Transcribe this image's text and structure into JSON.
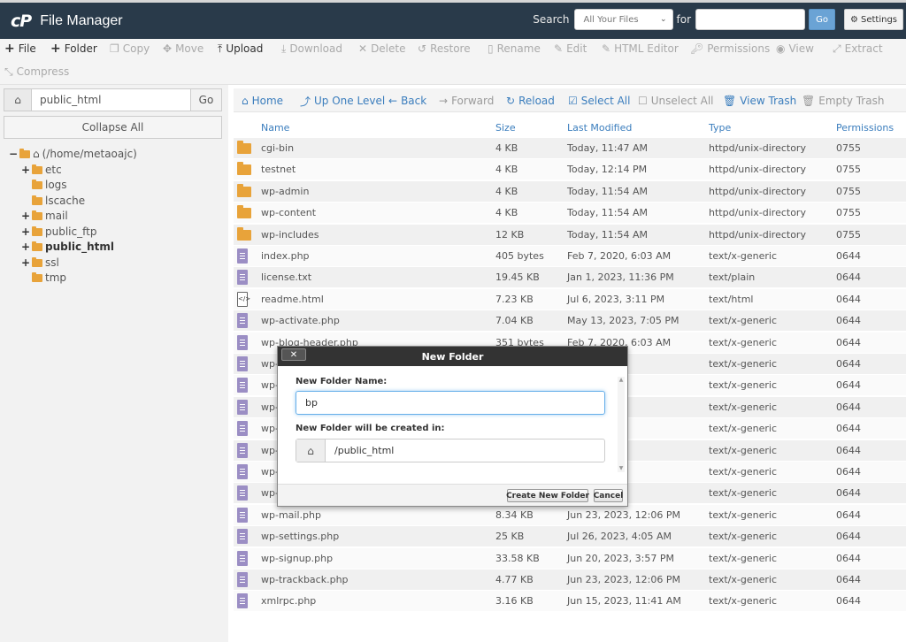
{
  "header": {
    "logo": "cP",
    "title": "File Manager",
    "search_label": "Search",
    "search_scope": "All Your Files",
    "for_label": "for",
    "search_value": "",
    "go_label": "Go",
    "settings_label": "Settings"
  },
  "toolbar": {
    "items": [
      {
        "label": "File",
        "icon": "plus-icon",
        "enabled": true
      },
      {
        "label": "Folder",
        "icon": "plus-icon",
        "enabled": true
      },
      {
        "label": "Copy",
        "icon": "copy-icon",
        "enabled": false
      },
      {
        "label": "Move",
        "icon": "move-icon",
        "enabled": false
      },
      {
        "label": "Upload",
        "icon": "upload-icon",
        "enabled": true
      },
      {
        "label": "Download",
        "icon": "download-icon",
        "enabled": false
      },
      {
        "label": "Delete",
        "icon": "delete-icon",
        "enabled": false
      },
      {
        "label": "Restore",
        "icon": "restore-icon",
        "enabled": false
      },
      {
        "label": "Rename",
        "icon": "rename-icon",
        "enabled": false
      },
      {
        "label": "Edit",
        "icon": "edit-icon",
        "enabled": false
      },
      {
        "label": "HTML Editor",
        "icon": "html-editor-icon",
        "enabled": false
      },
      {
        "label": "Permissions",
        "icon": "key-icon",
        "enabled": false
      },
      {
        "label": "View",
        "icon": "eye-icon",
        "enabled": false
      },
      {
        "label": "Extract",
        "icon": "extract-icon",
        "enabled": false
      },
      {
        "label": "Compress",
        "icon": "compress-icon",
        "enabled": false
      }
    ]
  },
  "sidebar": {
    "path_value": "public_html",
    "go_label": "Go",
    "collapse_label": "Collapse All",
    "tree": [
      {
        "label": "(/home/metaoajc)",
        "toggle": "−",
        "home": true
      },
      {
        "label": "etc",
        "toggle": "+"
      },
      {
        "label": "logs",
        "toggle": ""
      },
      {
        "label": "lscache",
        "toggle": ""
      },
      {
        "label": "mail",
        "toggle": "+"
      },
      {
        "label": "public_ftp",
        "toggle": "+"
      },
      {
        "label": "public_html",
        "toggle": "+",
        "bold": true
      },
      {
        "label": "ssl",
        "toggle": "+"
      },
      {
        "label": "tmp",
        "toggle": ""
      }
    ]
  },
  "nav": {
    "home": "Home",
    "up": "Up One Level",
    "back": "Back",
    "forward": "Forward",
    "reload": "Reload",
    "select_all": "Select All",
    "unselect_all": "Unselect All",
    "view_trash": "View Trash",
    "empty_trash": "Empty Trash"
  },
  "table": {
    "columns": [
      "Name",
      "Size",
      "Last Modified",
      "Type",
      "Permissions"
    ],
    "rows": [
      {
        "icon": "folder",
        "name": "cgi-bin",
        "size": "4 KB",
        "modified": "Today, 11:47 AM",
        "type": "httpd/unix-directory",
        "perms": "0755"
      },
      {
        "icon": "folder",
        "name": "testnet",
        "size": "4 KB",
        "modified": "Today, 12:14 PM",
        "type": "httpd/unix-directory",
        "perms": "0755"
      },
      {
        "icon": "folder",
        "name": "wp-admin",
        "size": "4 KB",
        "modified": "Today, 11:54 AM",
        "type": "httpd/unix-directory",
        "perms": "0755"
      },
      {
        "icon": "folder",
        "name": "wp-content",
        "size": "4 KB",
        "modified": "Today, 11:54 AM",
        "type": "httpd/unix-directory",
        "perms": "0755"
      },
      {
        "icon": "folder",
        "name": "wp-includes",
        "size": "12 KB",
        "modified": "Today, 11:54 AM",
        "type": "httpd/unix-directory",
        "perms": "0755"
      },
      {
        "icon": "file",
        "name": "index.php",
        "size": "405 bytes",
        "modified": "Feb 7, 2020, 6:03 AM",
        "type": "text/x-generic",
        "perms": "0644"
      },
      {
        "icon": "file",
        "name": "license.txt",
        "size": "19.45 KB",
        "modified": "Jan 1, 2023, 11:36 PM",
        "type": "text/plain",
        "perms": "0644"
      },
      {
        "icon": "html",
        "name": "readme.html",
        "size": "7.23 KB",
        "modified": "Jul 6, 2023, 3:11 PM",
        "type": "text/html",
        "perms": "0644"
      },
      {
        "icon": "file",
        "name": "wp-activate.php",
        "size": "7.04 KB",
        "modified": "May 13, 2023, 7:05 PM",
        "type": "text/x-generic",
        "perms": "0644"
      },
      {
        "icon": "file",
        "name": "wp-blog-header.php",
        "size": "351 bytes",
        "modified": "Feb 7, 2020, 6:03 AM",
        "type": "text/x-generic",
        "perms": "0644"
      },
      {
        "icon": "file",
        "name": "wp-",
        "size": "",
        "modified": "11:41 AM",
        "type": "text/x-generic",
        "perms": "0644"
      },
      {
        "icon": "file",
        "name": "wp-",
        "size": "",
        "modified": "10:08 AM",
        "type": "text/x-generic",
        "perms": "0644"
      },
      {
        "icon": "file",
        "name": "wp-",
        "size": "",
        "modified": "AM",
        "type": "text/x-generic",
        "perms": "0644"
      },
      {
        "icon": "file",
        "name": "wp-",
        "size": "",
        "modified": "4:18 PM",
        "type": "text/x-generic",
        "perms": "0644"
      },
      {
        "icon": "file",
        "name": "wp-",
        "size": "",
        "modified": "8:31 PM",
        "type": "text/x-generic",
        "perms": "0644"
      },
      {
        "icon": "file",
        "name": "wp-",
        "size": "",
        "modified": "9:46 AM",
        "type": "text/x-generic",
        "perms": "0644"
      },
      {
        "icon": "file",
        "name": "wp-",
        "size": "",
        "modified": "10:48 AM",
        "type": "text/x-generic",
        "perms": "0644"
      },
      {
        "icon": "file",
        "name": "wp-mail.php",
        "size": "8.34 KB",
        "modified": "Jun 23, 2023, 12:06 PM",
        "type": "text/x-generic",
        "perms": "0644"
      },
      {
        "icon": "file",
        "name": "wp-settings.php",
        "size": "25 KB",
        "modified": "Jul 26, 2023, 4:05 AM",
        "type": "text/x-generic",
        "perms": "0644"
      },
      {
        "icon": "file",
        "name": "wp-signup.php",
        "size": "33.58 KB",
        "modified": "Jun 20, 2023, 3:57 PM",
        "type": "text/x-generic",
        "perms": "0644"
      },
      {
        "icon": "file",
        "name": "wp-trackback.php",
        "size": "4.77 KB",
        "modified": "Jun 23, 2023, 12:06 PM",
        "type": "text/x-generic",
        "perms": "0644"
      },
      {
        "icon": "file",
        "name": "xmlrpc.php",
        "size": "3.16 KB",
        "modified": "Jun 15, 2023, 11:41 AM",
        "type": "text/x-generic",
        "perms": "0644"
      }
    ]
  },
  "dialog": {
    "title": "New Folder",
    "close_label": "✕",
    "name_label": "New Folder Name:",
    "name_value": "bp",
    "location_label": "New Folder will be created in:",
    "location_value": "/public_html",
    "create_label": "Create New Folder",
    "cancel_label": "Cancel"
  },
  "colors": {
    "header_bg": "#293a4a",
    "link": "#3a7dbd",
    "folder": "#e8a33a",
    "file": "#9b8ec4"
  }
}
